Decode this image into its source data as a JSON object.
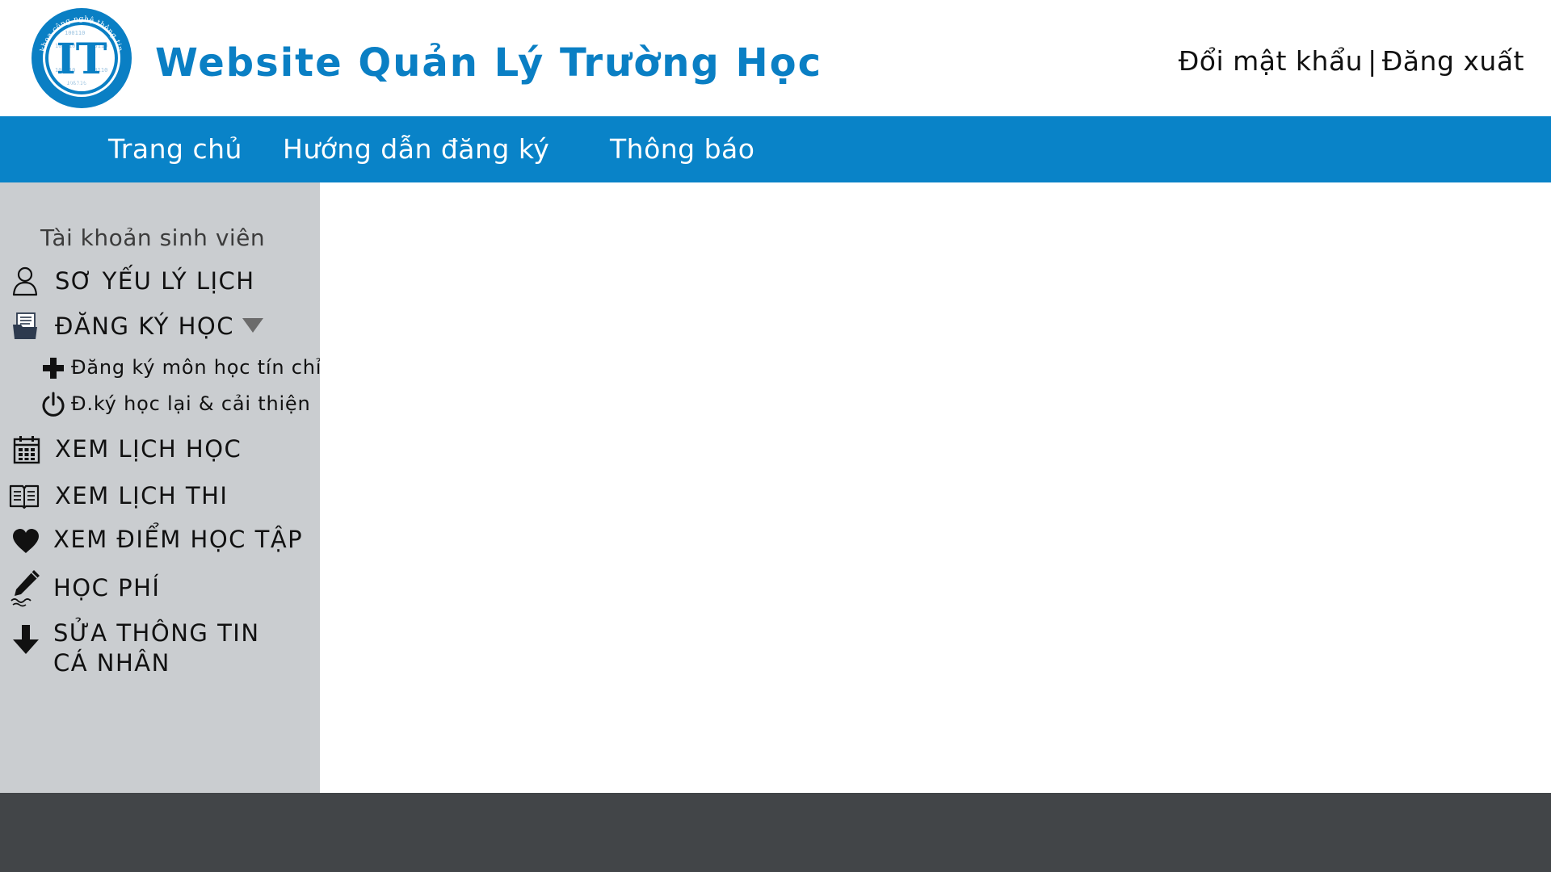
{
  "header": {
    "logo": {
      "initials": "IT",
      "ring_top_text": "khoa công nghệ thông tin",
      "ring_bottom_text": "ĐHSPHN",
      "binary_text": "100110",
      "colors": {
        "primary": "#0a7fc4",
        "ring": "#ffffff"
      }
    },
    "title": "Website Quản Lý Trường Học",
    "links": {
      "change_password": "Đổi mật khẩu",
      "separator": "|",
      "logout": "Đăng xuất"
    }
  },
  "nav": {
    "items": [
      {
        "label": "Trang chủ"
      },
      {
        "label": "Hướng dẫn đăng ký"
      },
      {
        "label": "Thông báo"
      }
    ]
  },
  "sidebar": {
    "heading": "Tài khoản sinh viên",
    "items": [
      {
        "label": "SƠ YẾU LÝ LỊCH",
        "icon": "user-outline-icon"
      },
      {
        "label": "ĐĂNG KÝ HỌC",
        "icon": "folder-documents-icon",
        "expanded": true,
        "children": [
          {
            "label": "Đăng ký môn học tín chỉ",
            "icon": "plus-icon"
          },
          {
            "label": "Đ.ký học lại & cải thiện",
            "icon": "power-icon"
          }
        ]
      },
      {
        "label": "XEM LỊCH HỌC",
        "icon": "calendar-icon"
      },
      {
        "label": "XEM LỊCH THI",
        "icon": "open-book-icon"
      },
      {
        "label": "XEM ĐIỂM HỌC TẬP",
        "icon": "heart-icon"
      },
      {
        "label": "HỌC PHÍ",
        "icon": "pencil-icon"
      },
      {
        "label_line1": "SỬA THÔNG TIN",
        "label_line2": "CÁ NHÂN",
        "icon": "arrow-down-icon"
      }
    ]
  },
  "colors": {
    "brand_blue": "#0a7fc4",
    "nav_bg": "#0983c8",
    "sidebar_bg": "#cacdd0",
    "footer_bg": "#424548",
    "text": "#111111"
  }
}
